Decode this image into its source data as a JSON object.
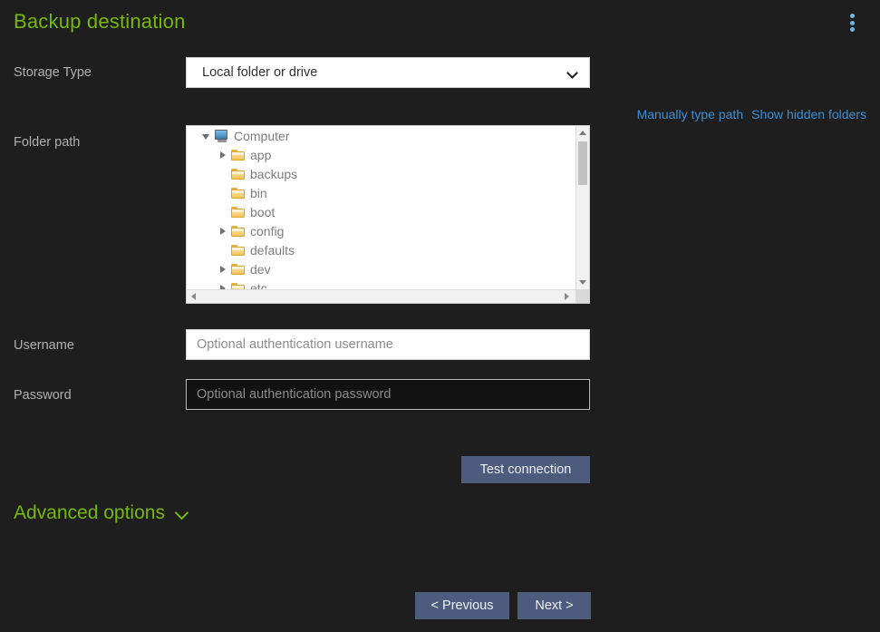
{
  "header": {
    "title": "Backup destination",
    "menu_icon": "kebab-menu-icon",
    "menu_color": "#6cb8ea"
  },
  "theme": {
    "background": "#1d1e1d",
    "accent_green": "#76b900",
    "link_blue": "#3b8fd4",
    "button_bg": "#4d5b7c"
  },
  "storage_type": {
    "label": "Storage Type",
    "selected": "Local folder or drive",
    "options": [
      "Local folder or drive"
    ],
    "caret_icon": "chevron-down-icon"
  },
  "tree_links": {
    "manual_path": "Manually type path",
    "show_hidden": "Show hidden folders"
  },
  "folder_path": {
    "label": "Folder path",
    "nodes": [
      {
        "label": "Computer",
        "icon": "computer-icon",
        "depth": 0,
        "twisty": "open"
      },
      {
        "label": "app",
        "icon": "folder-icon",
        "depth": 1,
        "twisty": "closed"
      },
      {
        "label": "backups",
        "icon": "folder-icon",
        "depth": 1,
        "twisty": "none"
      },
      {
        "label": "bin",
        "icon": "folder-icon",
        "depth": 1,
        "twisty": "none"
      },
      {
        "label": "boot",
        "icon": "folder-icon",
        "depth": 1,
        "twisty": "none"
      },
      {
        "label": "config",
        "icon": "folder-icon",
        "depth": 1,
        "twisty": "closed"
      },
      {
        "label": "defaults",
        "icon": "folder-icon",
        "depth": 1,
        "twisty": "none"
      },
      {
        "label": "dev",
        "icon": "folder-icon",
        "depth": 1,
        "twisty": "closed"
      },
      {
        "label": "etc",
        "icon": "folder-icon",
        "depth": 1,
        "twisty": "closed"
      }
    ]
  },
  "username": {
    "label": "Username",
    "value": "",
    "placeholder": "Optional authentication username"
  },
  "password": {
    "label": "Password",
    "value": "",
    "placeholder": "Optional authentication password"
  },
  "test_connection": {
    "label": "Test connection"
  },
  "advanced_options": {
    "label": "Advanced options",
    "chevron_icon": "chevron-down-icon",
    "expanded": false
  },
  "wizard_nav": {
    "previous": "< Previous",
    "next": "Next >"
  }
}
